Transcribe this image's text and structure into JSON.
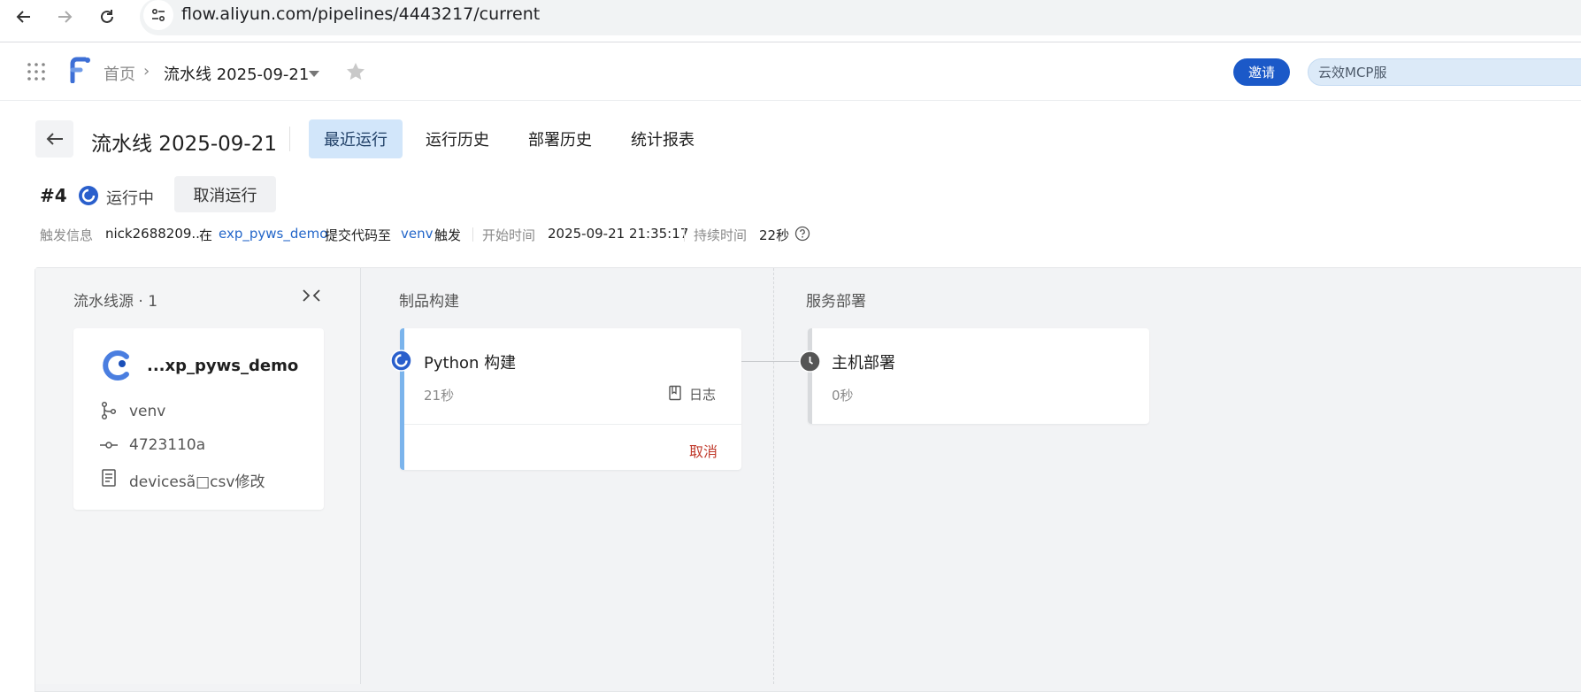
{
  "browser": {
    "url": "flow.aliyun.com/pipelines/4443217/current",
    "icons": [
      "back-arrow-icon",
      "forward-arrow-icon",
      "reload-icon",
      "site-info-icon"
    ]
  },
  "header": {
    "breadcrumb_home": "首页",
    "breadcrumb_sep": "›",
    "pipeline_name": "流水线 2025-09-21",
    "invite_label": "邀请",
    "mcp_label": "云效MCP服"
  },
  "page": {
    "title": "流水线 2025-09-21",
    "tabs": [
      {
        "label": "最近运行",
        "active": true
      },
      {
        "label": "运行历史",
        "active": false
      },
      {
        "label": "部署历史",
        "active": false
      },
      {
        "label": "统计报表",
        "active": false
      }
    ]
  },
  "run": {
    "number": "#4",
    "status": "运行中",
    "cancel_label": "取消运行"
  },
  "trigger": {
    "label": "触发信息",
    "user": "nick2688209...",
    "at": "在",
    "repo": "exp_pyws_demo",
    "action": "提交代码至",
    "branch": "venv",
    "triggered": "触发",
    "start_label": "开始时间",
    "start_time": "2025-09-21 21:35:17",
    "duration_label": "持续时间",
    "duration": "22秒"
  },
  "source_column": {
    "title": "流水线源 · 1",
    "repo_name": "...xp_pyws_demo",
    "branch": "venv",
    "commit": "4723110a",
    "message": "devicesã□csv修改"
  },
  "stages": [
    {
      "title": "制品构建",
      "job": {
        "name": "Python 构建",
        "duration": "21秒",
        "log_label": "日志",
        "cancel_label": "取消",
        "status": "running"
      }
    },
    {
      "title": "服务部署",
      "job": {
        "name": "主机部署",
        "duration": "0秒",
        "status": "waiting"
      }
    }
  ],
  "colors": {
    "accent": "#1b59c8",
    "active_tab_bg": "#d2e6fa",
    "running_bar": "#7bb4ec",
    "cancel_red": "#c0392b"
  }
}
